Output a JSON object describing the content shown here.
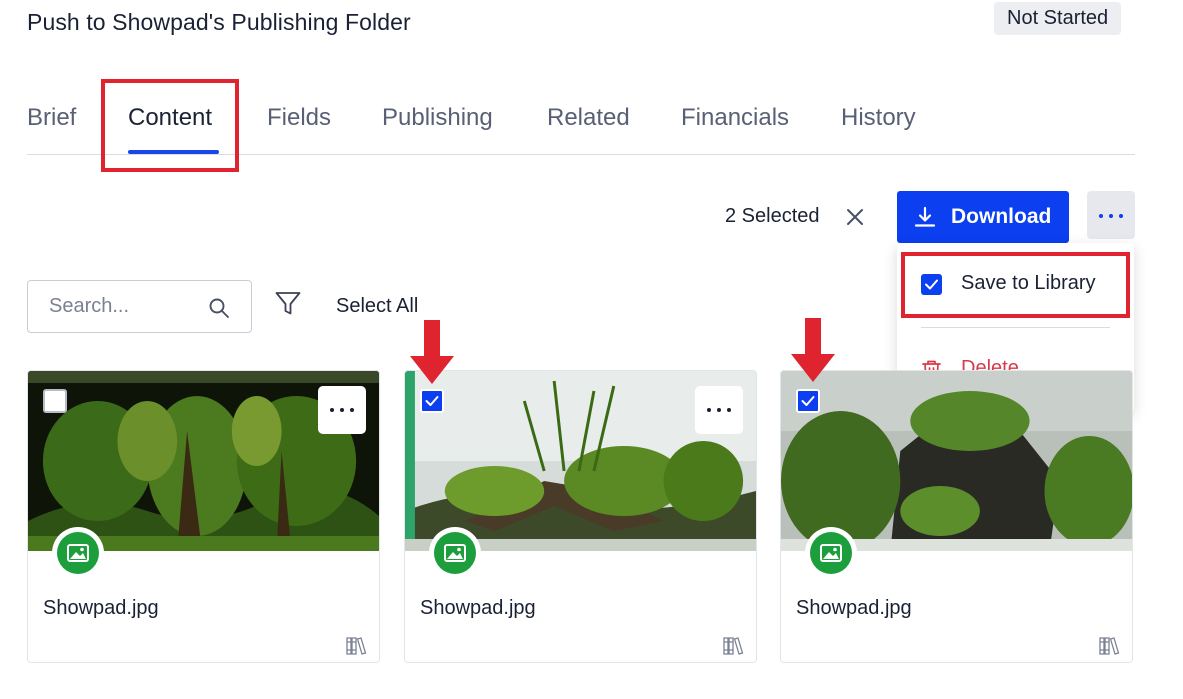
{
  "header": {
    "title": "Push to Showpad's Publishing Folder",
    "status": "Not Started"
  },
  "tabs": [
    {
      "label": "Brief"
    },
    {
      "label": "Content"
    },
    {
      "label": "Fields"
    },
    {
      "label": "Publishing"
    },
    {
      "label": "Related"
    },
    {
      "label": "Financials"
    },
    {
      "label": "History"
    }
  ],
  "active_tab": "Content",
  "toolbar": {
    "selected_text": "2 Selected",
    "download_label": "Download"
  },
  "menu": {
    "items": [
      {
        "label": "Save to Library",
        "checked": true
      },
      {
        "label": "Delete"
      }
    ]
  },
  "search": {
    "placeholder": "Search...",
    "value": ""
  },
  "select_all_label": "Select All",
  "cards": [
    {
      "name": "Showpad.jpg",
      "selected": false
    },
    {
      "name": "Showpad.jpg",
      "selected": true
    },
    {
      "name": "Showpad.jpg",
      "selected": true
    }
  ],
  "colors": {
    "accent": "#0b3ff0",
    "highlight": "#e0242f",
    "delete": "#d93a48",
    "image_badge": "#1c9e3c"
  }
}
